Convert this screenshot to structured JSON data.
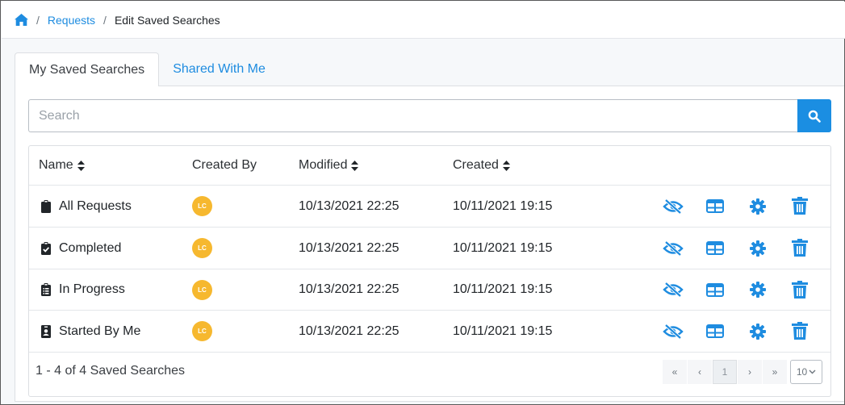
{
  "breadcrumb": {
    "home_icon": "home-icon",
    "items": [
      "Requests",
      "Edit Saved Searches"
    ],
    "separator": "/"
  },
  "tabs": [
    {
      "label": "My Saved Searches",
      "active": true
    },
    {
      "label": "Shared With Me",
      "active": false
    }
  ],
  "search": {
    "placeholder": "Search",
    "value": "",
    "button_icon": "search-icon"
  },
  "table": {
    "columns": [
      {
        "label": "Name",
        "sortable": true
      },
      {
        "label": "Created By",
        "sortable": false
      },
      {
        "label": "Modified",
        "sortable": true
      },
      {
        "label": "Created",
        "sortable": true
      }
    ],
    "rows": [
      {
        "icon": "clipboard-icon",
        "name": "All Requests",
        "created_by": "LC",
        "modified": "10/13/2021 22:25",
        "created": "10/11/2021 19:15"
      },
      {
        "icon": "clipboard-check-icon",
        "name": "Completed",
        "created_by": "LC",
        "modified": "10/13/2021 22:25",
        "created": "10/11/2021 19:15"
      },
      {
        "icon": "clipboard-list-icon",
        "name": "In Progress",
        "created_by": "LC",
        "modified": "10/13/2021 22:25",
        "created": "10/11/2021 19:15"
      },
      {
        "icon": "id-badge-icon",
        "name": "Started By Me",
        "created_by": "LC",
        "modified": "10/13/2021 22:25",
        "created": "10/11/2021 19:15"
      }
    ],
    "row_actions": [
      "eye-slash-icon",
      "table-columns-icon",
      "gear-icon",
      "trash-icon"
    ]
  },
  "footer": {
    "summary": "1 - 4 of 4 Saved Searches",
    "pagination": {
      "first": "«",
      "prev": "‹",
      "current_page": "1",
      "next": "›",
      "last": "»",
      "per_page": "10"
    }
  },
  "colors": {
    "accent": "#1e8ce0",
    "avatar": "#f6b82f",
    "text": "#212529"
  }
}
